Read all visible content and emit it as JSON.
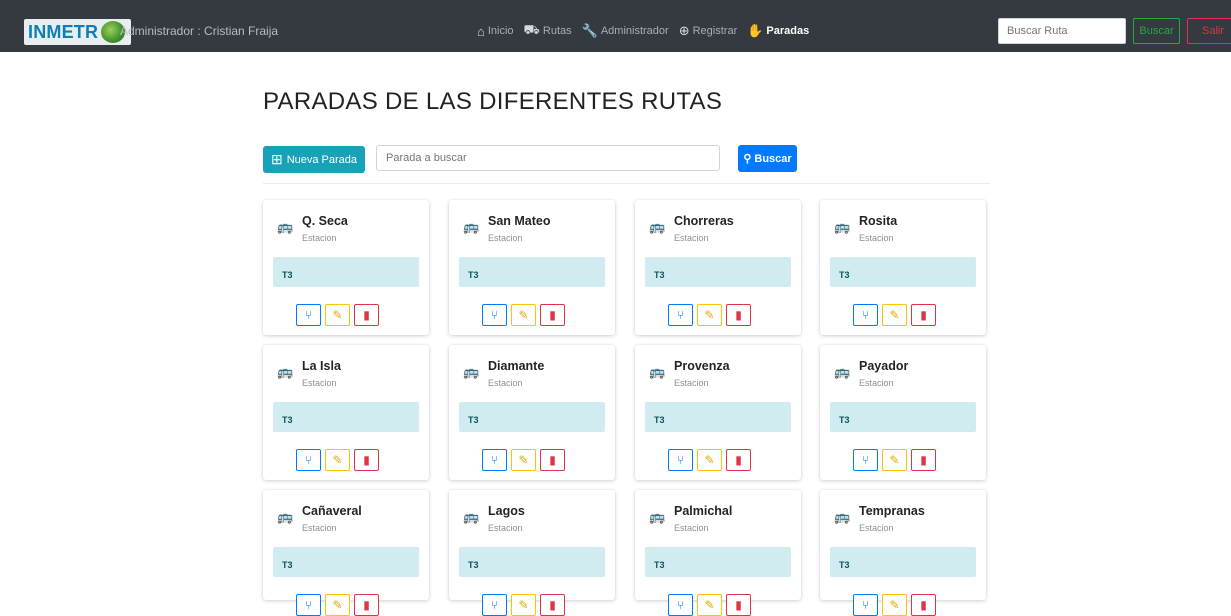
{
  "navbar": {
    "brand": "INMETR",
    "user": "Administrador : Cristian Fraija",
    "links": [
      {
        "label": "Inicio",
        "icon": "home-icon",
        "glyph": "⌂"
      },
      {
        "label": "Rutas",
        "icon": "bus-icon",
        "glyph": "⛟"
      },
      {
        "label": "Administrador",
        "icon": "wrench-icon",
        "glyph": "🔧"
      },
      {
        "label": "Registrar",
        "icon": "user-plus-icon",
        "glyph": "⊕"
      },
      {
        "label": "Paradas",
        "icon": "hand-icon",
        "glyph": "✋"
      }
    ],
    "search_placeholder": "Buscar Ruta",
    "search_button": "Buscar",
    "exit_button": "Salir"
  },
  "page": {
    "title": "PARADAS DE LAS DIFERENTES RUTAS",
    "new_button": "Nueva Parada",
    "search_placeholder": "Parada a buscar",
    "search_button": "Buscar"
  },
  "stops": [
    {
      "name": "Q. Seca",
      "type": "Estacion",
      "route": "T3"
    },
    {
      "name": "San Mateo",
      "type": "Estacion",
      "route": "T3"
    },
    {
      "name": "Chorreras",
      "type": "Estacion",
      "route": "T3"
    },
    {
      "name": "Rosita",
      "type": "Estacion",
      "route": "T3"
    },
    {
      "name": "La Isla",
      "type": "Estacion",
      "route": "T3"
    },
    {
      "name": "Diamante",
      "type": "Estacion",
      "route": "T3"
    },
    {
      "name": "Provenza",
      "type": "Estacion",
      "route": "T3"
    },
    {
      "name": "Payador",
      "type": "Estacion",
      "route": "T3"
    },
    {
      "name": "Cañaveral",
      "type": "Estacion",
      "route": "T3"
    },
    {
      "name": "Lagos",
      "type": "Estacion",
      "route": "T3"
    },
    {
      "name": "Palmichal",
      "type": "Estacion",
      "route": "T3"
    },
    {
      "name": "Tempranas",
      "type": "Estacion",
      "route": "T3"
    }
  ],
  "colors": {
    "navbar": "#343a40",
    "info": "#17a2b8",
    "primary": "#007bff",
    "warning": "#ffc107",
    "danger": "#dc3545",
    "success": "#28a745",
    "route_band": "#d1ecf1"
  }
}
